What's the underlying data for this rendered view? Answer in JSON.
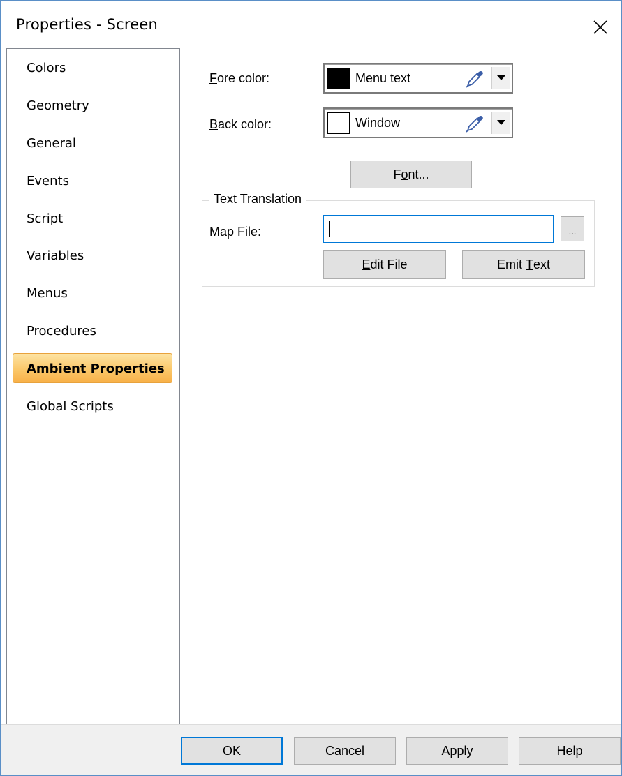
{
  "window": {
    "title": "Properties - Screen",
    "close_glyph": "×"
  },
  "nav": {
    "items": [
      {
        "label": "Colors"
      },
      {
        "label": "Geometry"
      },
      {
        "label": "General"
      },
      {
        "label": "Events"
      },
      {
        "label": "Script"
      },
      {
        "label": "Variables"
      },
      {
        "label": "Menus"
      },
      {
        "label": "Procedures"
      },
      {
        "label": "Ambient Properties",
        "selected": true
      },
      {
        "label": "Global Scripts"
      }
    ]
  },
  "fore_color": {
    "label_accel": "F",
    "label_rest": "ore color:",
    "value": "Menu text",
    "swatch": "#000000"
  },
  "back_color": {
    "label_accel": "B",
    "label_rest": "ack color:",
    "value": "Window",
    "swatch": "#ffffff"
  },
  "font_button": {
    "pre": "F",
    "accel": "o",
    "post": "nt..."
  },
  "text_translation": {
    "title": "Text Translation",
    "map_label_accel": "M",
    "map_label_rest": "ap File:",
    "map_value": "",
    "browse_label": "...",
    "edit_pre": "",
    "edit_accel": "E",
    "edit_post": "dit File",
    "emit_pre": "Emit ",
    "emit_accel": "T",
    "emit_post": "ext"
  },
  "footer": {
    "ok": "OK",
    "cancel": "Cancel",
    "apply_accel": "A",
    "apply_rest": "pply",
    "help": "Help"
  },
  "colors": {
    "accent": "#0078d7",
    "selected_nav": "#fbc86a"
  },
  "icons": {
    "close": "close-icon",
    "eyedropper": "eyedropper-icon",
    "dropdown": "chevron-down-icon"
  }
}
